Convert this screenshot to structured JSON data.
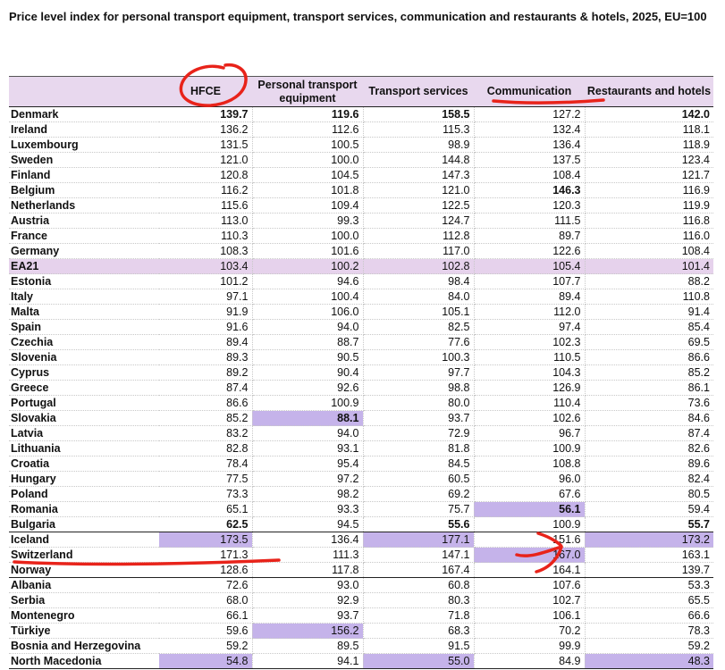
{
  "title": "Price level index for personal transport equipment, transport services, communication and restaurants & hotels, 2025, EU=100",
  "chart_data": {
    "type": "table",
    "columns": [
      "",
      "HFCE",
      "Personal transport equipment",
      "Transport services",
      "Communication",
      "Restaurants and hotels"
    ],
    "rows": [
      {
        "country": "Denmark",
        "values": [
          "139.7",
          "119.6",
          "158.5",
          "127.2",
          "142.0"
        ],
        "bold": [
          0,
          1,
          2,
          4
        ]
      },
      {
        "country": "Ireland",
        "values": [
          "136.2",
          "112.6",
          "115.3",
          "132.4",
          "118.1"
        ]
      },
      {
        "country": "Luxembourg",
        "values": [
          "131.5",
          "100.5",
          "98.9",
          "136.4",
          "118.9"
        ]
      },
      {
        "country": "Sweden",
        "values": [
          "121.0",
          "100.0",
          "144.8",
          "137.5",
          "123.4"
        ]
      },
      {
        "country": "Finland",
        "values": [
          "120.8",
          "104.5",
          "147.3",
          "108.4",
          "121.7"
        ]
      },
      {
        "country": "Belgium",
        "values": [
          "116.2",
          "101.8",
          "121.0",
          "146.3",
          "116.9"
        ],
        "bold": [
          3
        ]
      },
      {
        "country": "Netherlands",
        "values": [
          "115.6",
          "109.4",
          "122.5",
          "120.3",
          "119.9"
        ]
      },
      {
        "country": "Austria",
        "values": [
          "113.0",
          "99.3",
          "124.7",
          "111.5",
          "116.8"
        ]
      },
      {
        "country": "France",
        "values": [
          "110.3",
          "100.0",
          "112.8",
          "89.7",
          "116.0"
        ]
      },
      {
        "country": "Germany",
        "values": [
          "108.3",
          "101.6",
          "117.0",
          "122.6",
          "108.4"
        ]
      },
      {
        "country": "EA21",
        "values": [
          "103.4",
          "100.2",
          "102.8",
          "105.4",
          "101.4"
        ],
        "ea": true
      },
      {
        "country": "Estonia",
        "values": [
          "101.2",
          "94.6",
          "98.4",
          "107.7",
          "88.2"
        ]
      },
      {
        "country": "Italy",
        "values": [
          "97.1",
          "100.4",
          "84.0",
          "89.4",
          "110.8"
        ]
      },
      {
        "country": "Malta",
        "values": [
          "91.9",
          "106.0",
          "105.1",
          "112.0",
          "91.4"
        ]
      },
      {
        "country": "Spain",
        "values": [
          "91.6",
          "94.0",
          "82.5",
          "97.4",
          "85.4"
        ]
      },
      {
        "country": "Czechia",
        "values": [
          "89.4",
          "88.7",
          "77.6",
          "102.3",
          "69.5"
        ]
      },
      {
        "country": "Slovenia",
        "values": [
          "89.3",
          "90.5",
          "100.3",
          "110.5",
          "86.6"
        ]
      },
      {
        "country": "Cyprus",
        "values": [
          "89.2",
          "90.4",
          "97.7",
          "104.3",
          "85.2"
        ]
      },
      {
        "country": "Greece",
        "values": [
          "87.4",
          "92.6",
          "98.8",
          "126.9",
          "86.1"
        ]
      },
      {
        "country": "Portugal",
        "values": [
          "86.6",
          "100.9",
          "80.0",
          "110.4",
          "73.6"
        ]
      },
      {
        "country": "Slovakia",
        "values": [
          "85.2",
          "88.1",
          "93.7",
          "102.6",
          "84.6"
        ],
        "bold": [
          1
        ],
        "hl": [
          1
        ]
      },
      {
        "country": "Latvia",
        "values": [
          "83.2",
          "94.0",
          "72.9",
          "96.7",
          "87.4"
        ]
      },
      {
        "country": "Lithuania",
        "values": [
          "82.8",
          "93.1",
          "81.8",
          "100.9",
          "82.6"
        ]
      },
      {
        "country": "Croatia",
        "values": [
          "78.4",
          "95.4",
          "84.5",
          "108.8",
          "89.6"
        ]
      },
      {
        "country": "Hungary",
        "values": [
          "77.5",
          "97.2",
          "60.5",
          "96.0",
          "82.4"
        ]
      },
      {
        "country": "Poland",
        "values": [
          "73.3",
          "98.2",
          "69.2",
          "67.6",
          "80.5"
        ]
      },
      {
        "country": "Romania",
        "values": [
          "65.1",
          "93.3",
          "75.7",
          "56.1",
          "59.4"
        ],
        "bold": [
          3
        ],
        "hl": [
          3
        ]
      },
      {
        "country": "Bulgaria",
        "values": [
          "62.5",
          "94.5",
          "55.6",
          "100.9",
          "55.7"
        ],
        "bold": [
          0,
          2,
          4
        ]
      },
      {
        "country": "Iceland",
        "values": [
          "173.5",
          "136.4",
          "177.1",
          "151.6",
          "173.2"
        ],
        "hl": [
          0,
          2,
          4
        ],
        "sep": true
      },
      {
        "country": "Switzerland",
        "values": [
          "171.3",
          "111.3",
          "147.1",
          "167.0",
          "163.1"
        ],
        "hl": [
          3
        ]
      },
      {
        "country": "Norway",
        "values": [
          "128.6",
          "117.8",
          "167.4",
          "164.1",
          "139.7"
        ]
      },
      {
        "country": "Albania",
        "values": [
          "72.6",
          "93.0",
          "60.8",
          "107.6",
          "53.3"
        ],
        "sep": true
      },
      {
        "country": "Serbia",
        "values": [
          "68.0",
          "92.9",
          "80.3",
          "102.7",
          "65.5"
        ]
      },
      {
        "country": "Montenegro",
        "values": [
          "66.1",
          "93.7",
          "71.8",
          "106.1",
          "66.6"
        ]
      },
      {
        "country": "Türkiye",
        "values": [
          "59.6",
          "156.2",
          "68.3",
          "70.2",
          "78.3"
        ],
        "hl": [
          1
        ]
      },
      {
        "country": "Bosnia and Herzegovina",
        "values": [
          "59.2",
          "89.5",
          "91.5",
          "99.9",
          "59.2"
        ]
      },
      {
        "country": "North Macedonia",
        "values": [
          "54.8",
          "94.1",
          "55.0",
          "84.9",
          "48.3"
        ],
        "hl": [
          0,
          2,
          4
        ]
      }
    ]
  },
  "colors": {
    "header_bg": "#e8d8ee",
    "ea_row_bg": "#e6d2ec",
    "highlight_bg": "#c5b3ea",
    "annotation_red": "#e8231a"
  }
}
